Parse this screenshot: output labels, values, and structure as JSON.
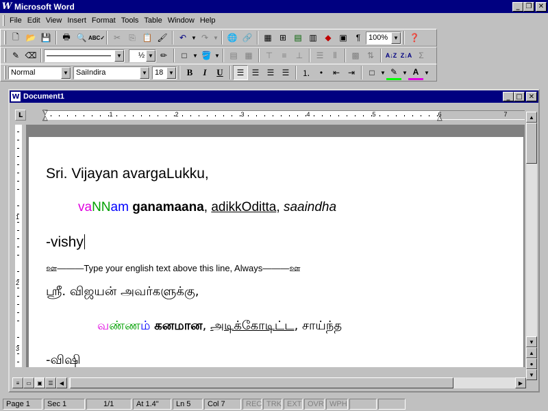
{
  "app": {
    "title": "Microsoft Word"
  },
  "menu": [
    "File",
    "Edit",
    "View",
    "Insert",
    "Format",
    "Tools",
    "Table",
    "Window",
    "Help"
  ],
  "standard_toolbar": {
    "zoom": "100%"
  },
  "drawing_toolbar": {
    "line_weight": "½"
  },
  "formatting_toolbar": {
    "style": "Normal",
    "font": "SaiIndira",
    "size": "18",
    "bold": "B",
    "italic": "I",
    "underline": "U"
  },
  "document_window": {
    "title": "Document1"
  },
  "ruler": {
    "numbers": [
      "1",
      "2",
      "3",
      "4",
      "5",
      "6",
      "7"
    ],
    "vertical_numbers": [
      "1",
      "2",
      "3"
    ]
  },
  "document": {
    "salutation": "Sri. Vijayan avargaLukku,",
    "words_line": {
      "va": "va",
      "NN": "NN",
      "am": "am",
      "w2": "ganamaana",
      "sep1": ",",
      "w3": "adikkOditta",
      "sep2": ",",
      "w4": "saaindha"
    },
    "signature": "-vishy",
    "separator_note": "ஊ———Type your english text above this line, Always———ஊ",
    "tamil_salutation": "ஸ்ரீ. விஜயன் அவர்களுக்கு,",
    "tamil_words": {
      "va": "வ",
      "NN": "ண்ண",
      "am": "ம்",
      "w2": "கனமான",
      "sep1": ",",
      "w3": "அடிக்கோடிட்ட",
      "sep2": ",",
      "w4": "சாய்ந்த"
    },
    "tamil_signature": "-விஷி"
  },
  "status_bar": {
    "page": "Page 1",
    "sec": "Sec 1",
    "pages": "1/1",
    "at": "At 1.4\"",
    "ln": "Ln 5",
    "col": "Col 7",
    "rec": "REC",
    "trk": "TRK",
    "ext": "EXT",
    "ovr": "OVR",
    "wph": "WPH"
  },
  "colors": {
    "title_bar": "#000080",
    "face": "#c0c0c0",
    "magenta": "#e000e0",
    "green": "#00a000",
    "blue": "#0000ff"
  },
  "icons": [
    "new-document-icon",
    "open-folder-icon",
    "save-icon",
    "print-icon",
    "print-preview-icon",
    "spelling-icon",
    "cut-icon",
    "copy-icon",
    "paste-icon",
    "format-painter-icon",
    "undo-icon",
    "redo-icon",
    "web-toolbar-icon",
    "hyperlink-icon",
    "tables-borders-icon",
    "insert-table-icon",
    "insert-excel-icon",
    "columns-icon",
    "drawing-icon",
    "document-map-icon",
    "show-hide-icon",
    "office-assistant-icon"
  ]
}
